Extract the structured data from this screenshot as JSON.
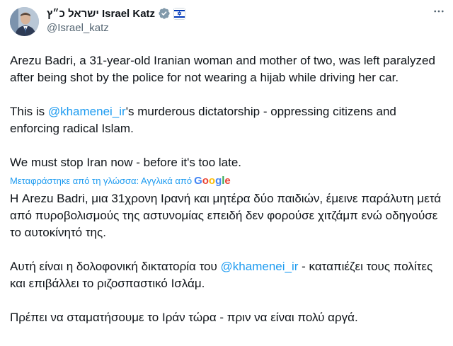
{
  "author": {
    "display_name": "ישראל כ״ץ Israel Katz",
    "handle": "@Israel_katz",
    "avatar_icon": "avatar-photo",
    "verified_icon": "verified-badge-icon",
    "affiliation_icon": "israel-flag-icon"
  },
  "tweet": {
    "p1": "Arezu Badri, a 31-year-old Iranian woman and mother of two, was left paralyzed after being shot by the police for not wearing a hijab while driving her car.",
    "p2_before": "This is ",
    "p2_mention": "@khamenei_ir",
    "p2_after": "'s murderous dictatorship - oppressing citizens and enforcing radical Islam.",
    "p3": "We must stop Iran now - before it's too late."
  },
  "translation": {
    "label": "Μεταφράστηκε από τη γλώσσα: Αγγλικά από",
    "provider": "Google",
    "p1": "Η Arezu Badri, μια 31χρονη Ιρανή και μητέρα δύο παιδιών, έμεινε παράλυτη μετά από πυροβολισμούς της αστυνομίας επειδή δεν φορούσε χιτζάμπ ενώ οδηγούσε το αυτοκίνητό της.",
    "p2_before": "Αυτή είναι η δολοφονική δικτατορία του ",
    "p2_mention": "@khamenei_ir",
    "p2_after": " - καταπιέζει τους πολίτες και επιβάλλει το ριζοσπαστικό Ισλάμ.",
    "p3": "Πρέπει να σταματήσουμε το Ιράν τώρα - πριν να είναι πολύ αργά."
  },
  "colors": {
    "link": "#1d9bf0",
    "secondary_text": "#536471",
    "primary_text": "#0f1419"
  },
  "more_icon": "more-horizontal-icon"
}
